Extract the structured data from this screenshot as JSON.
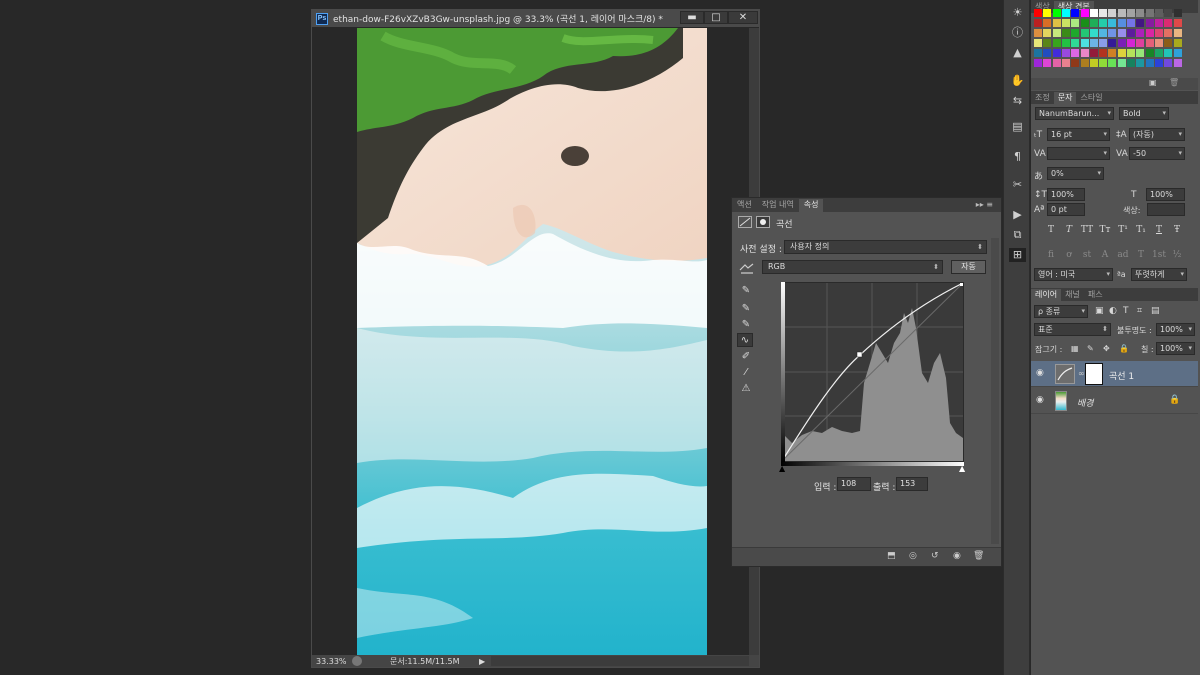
{
  "document": {
    "ps_icon": "Ps",
    "title": "ethan-dow-F26vXZvB3Gw-unsplash.jpg @ 33.3% (곡선 1, 레이어 마스크/8) *",
    "controls": {
      "minimize": "▬",
      "restore": "□",
      "close": "✕"
    },
    "zoom": "33.33%",
    "doc_size": "문서:11.5M/11.5M",
    "status_arrow": "▶"
  },
  "properties_panel": {
    "tabs": [
      "액션",
      "작업 내역",
      "속성"
    ],
    "active_tab": 2,
    "menu_arrows": "▸▸ ≡",
    "header_title": "곡선",
    "preset_label": "사전 설정 :",
    "preset_value": "사용자 정의",
    "channel_value": "RGB",
    "auto_button": "자동",
    "input_label": "입력 :",
    "input_value": "108",
    "output_label": "출력 :",
    "output_value": "153",
    "curve_point": {
      "input": 108,
      "output": 153
    }
  },
  "swatches_panel": {
    "tabs": [
      "색상",
      "색상 견본"
    ]
  },
  "character_panel": {
    "tabs": [
      "조정",
      "문자",
      "스타일"
    ],
    "font_family": "NanumBarun...",
    "font_style": "Bold",
    "font_size": "16 pt",
    "leading": "(자동)",
    "kerning": "",
    "tracking": "-50",
    "tsume": "0%",
    "vertical_scale": "100%",
    "horizontal_scale": "100%",
    "baseline_shift": "0 pt",
    "color_label": "색상:",
    "language": "영어 : 미국",
    "aa_label": "a",
    "antialias": "뚜렷하게",
    "style_buttons": [
      "T",
      "T",
      "TT",
      "Tт",
      "T¹",
      "T₁",
      "T",
      "Ŧ"
    ],
    "opentype_buttons": [
      "fi",
      "ơ",
      "st",
      "A",
      "ad",
      "T",
      "1st",
      "½"
    ]
  },
  "layers_panel": {
    "tabs": [
      "레이어",
      "채널",
      "패스"
    ],
    "filter_kind": "ρ 종류",
    "blend_mode": "표준",
    "opacity_label": "불투명도 :",
    "opacity": "100%",
    "lock_label": "잠그기 :",
    "fill_label": "칠 :",
    "fill": "100%",
    "layers": [
      {
        "name": "곡선 1",
        "selected": true
      },
      {
        "name": "배경",
        "selected": false
      }
    ]
  },
  "icons": [
    "ps-app-icon",
    "eyedropper-icon",
    "curve-icon",
    "eye-icon",
    "trash-icon",
    "lock-icon"
  ]
}
